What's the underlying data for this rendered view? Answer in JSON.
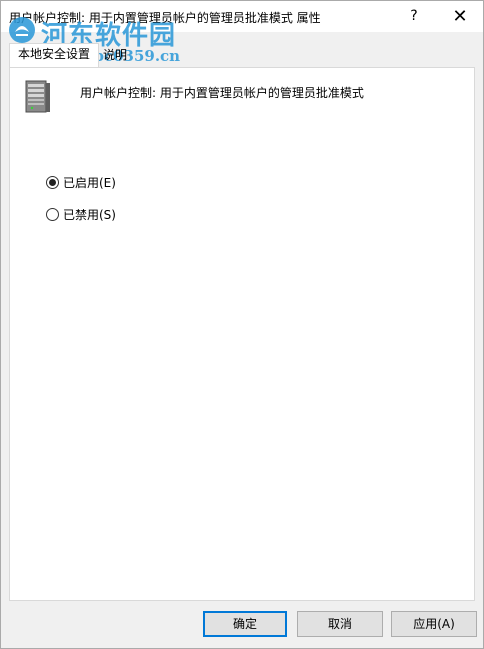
{
  "window": {
    "title": "用户帐户控制: 用于内置管理员帐户的管理员批准模式 属性",
    "help_glyph": "?",
    "close_glyph": "✕"
  },
  "watermark": {
    "name": "河东软件园",
    "url": "www.pc0359.cn"
  },
  "tabs": [
    {
      "label": "本地安全设置",
      "selected": true
    },
    {
      "label": "说明",
      "selected": false
    }
  ],
  "policy": {
    "icon": "server-icon",
    "title": "用户帐户控制: 用于内置管理员帐户的管理员批准模式"
  },
  "options": [
    {
      "label": "已启用(E)",
      "checked": true
    },
    {
      "label": "已禁用(S)",
      "checked": false
    }
  ],
  "buttons": {
    "ok": "确定",
    "cancel": "取消",
    "apply": "应用(A)"
  },
  "colors": {
    "accent": "#0078d7",
    "watermark": "#2896d7"
  }
}
